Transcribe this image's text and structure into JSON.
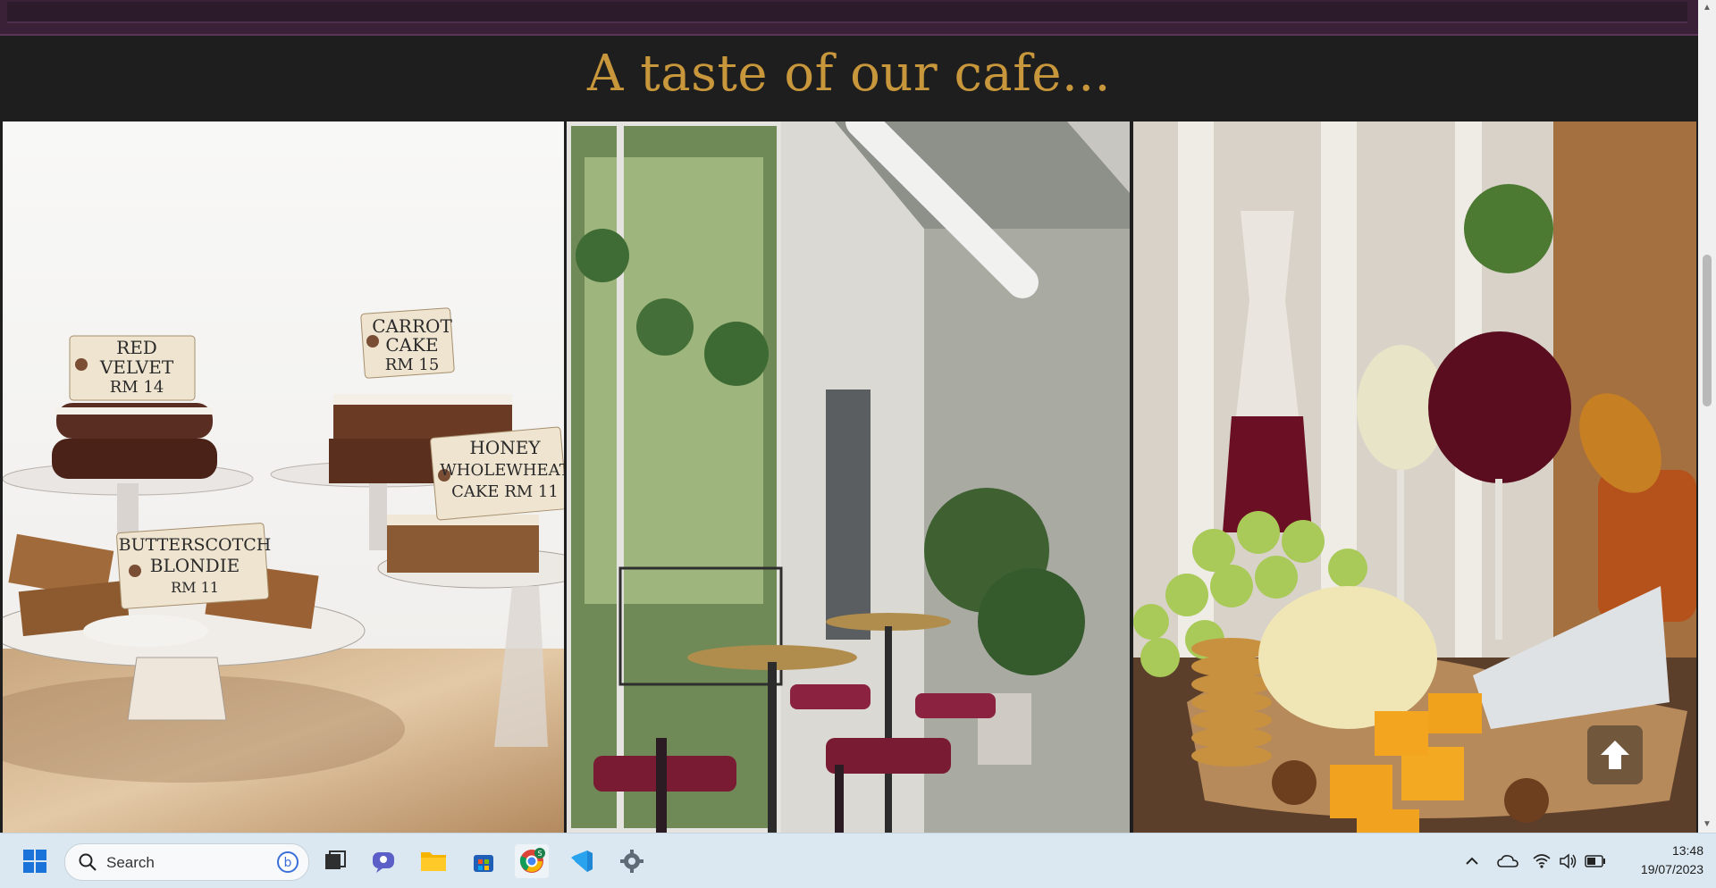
{
  "page": {
    "heading": "A taste of our cafe..."
  },
  "gallery": {
    "images": [
      {
        "alt": "cakes on stands",
        "tags": [
          {
            "line1": "RED",
            "line2": "VELVET",
            "line3": "RM 14"
          },
          {
            "line1": "CARROT",
            "line2": "CAKE",
            "line3": "RM 15"
          },
          {
            "line1": "HONEY",
            "line2": "WHOLEWHEAT",
            "line3": "CAKE RM 11"
          },
          {
            "line1": "BUTTERSCOTCH",
            "line2": "BLONDIE",
            "line3": "RM 11"
          }
        ]
      },
      {
        "alt": "cafe interior with hanging plants"
      },
      {
        "alt": "wine, cheese and grapes"
      }
    ]
  },
  "taskbar": {
    "search_placeholder": "Search",
    "time": "13:48",
    "date": "19/07/2023",
    "apps": [
      "start-icon",
      "search",
      "task-view-icon",
      "chat-icon",
      "file-explorer-icon",
      "store-icon",
      "chrome-icon",
      "vscode-icon",
      "settings-icon"
    ]
  },
  "colors": {
    "heading": "#c9973b",
    "background": "#1e1e1e",
    "top_bar": "#3a2138"
  }
}
